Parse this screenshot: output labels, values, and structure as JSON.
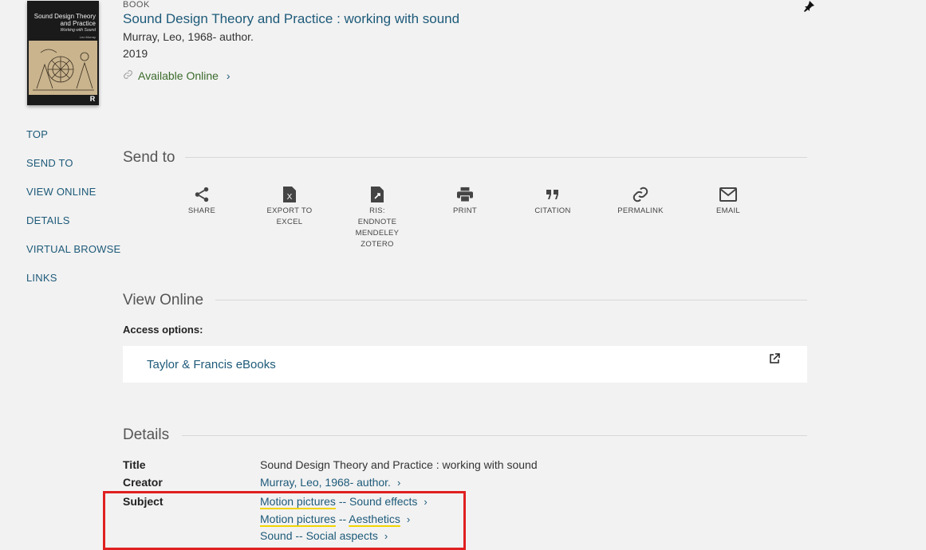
{
  "record": {
    "type": "BOOK",
    "title": "Sound Design Theory and Practice : working with sound",
    "creator": "Murray, Leo, 1968- author.",
    "year": "2019",
    "availability": "Available Online"
  },
  "cover": {
    "title": "Sound Design Theory and Practice",
    "subtitle": "Working with Sound",
    "author": "Leo Murray",
    "logo": "R"
  },
  "nav": [
    "TOP",
    "SEND TO",
    "VIEW ONLINE",
    "DETAILS",
    "VIRTUAL BROWSE",
    "LINKS"
  ],
  "send_to": {
    "heading": "Send to",
    "actions": [
      {
        "label": "SHARE",
        "icon": "share-icon"
      },
      {
        "label": "EXPORT TO EXCEL",
        "icon": "excel-icon"
      },
      {
        "label": "RIS: ENDNOTE MENDELEY ZOTERO",
        "icon": "ris-file-icon"
      },
      {
        "label": "PRINT",
        "icon": "print-icon"
      },
      {
        "label": "CITATION",
        "icon": "quote-icon"
      },
      {
        "label": "PERMALINK",
        "icon": "link-icon"
      },
      {
        "label": "EMAIL",
        "icon": "email-icon"
      }
    ]
  },
  "view_online": {
    "heading": "View Online",
    "access_label": "Access options:",
    "provider": "Taylor & Francis eBooks"
  },
  "details": {
    "heading": "Details",
    "title_label": "Title",
    "title_value": "Sound Design Theory and Practice : working with sound",
    "creator_label": "Creator",
    "creator_value": "Murray, Leo, 1968- author.",
    "subject_label": "Subject",
    "subjects": [
      {
        "a": "Motion pictures",
        "sep": " -- ",
        "b": "Sound effects"
      },
      {
        "a": "Motion pictures",
        "sep": " -- ",
        "b": "Aesthetics"
      },
      {
        "a": "Sound",
        "sep": " -- ",
        "b": "Social aspects"
      }
    ]
  },
  "colors": {
    "link": "#1d5a79",
    "available": "#3b6b2c",
    "highlight": "#e02020",
    "underline": "#f1d500"
  }
}
